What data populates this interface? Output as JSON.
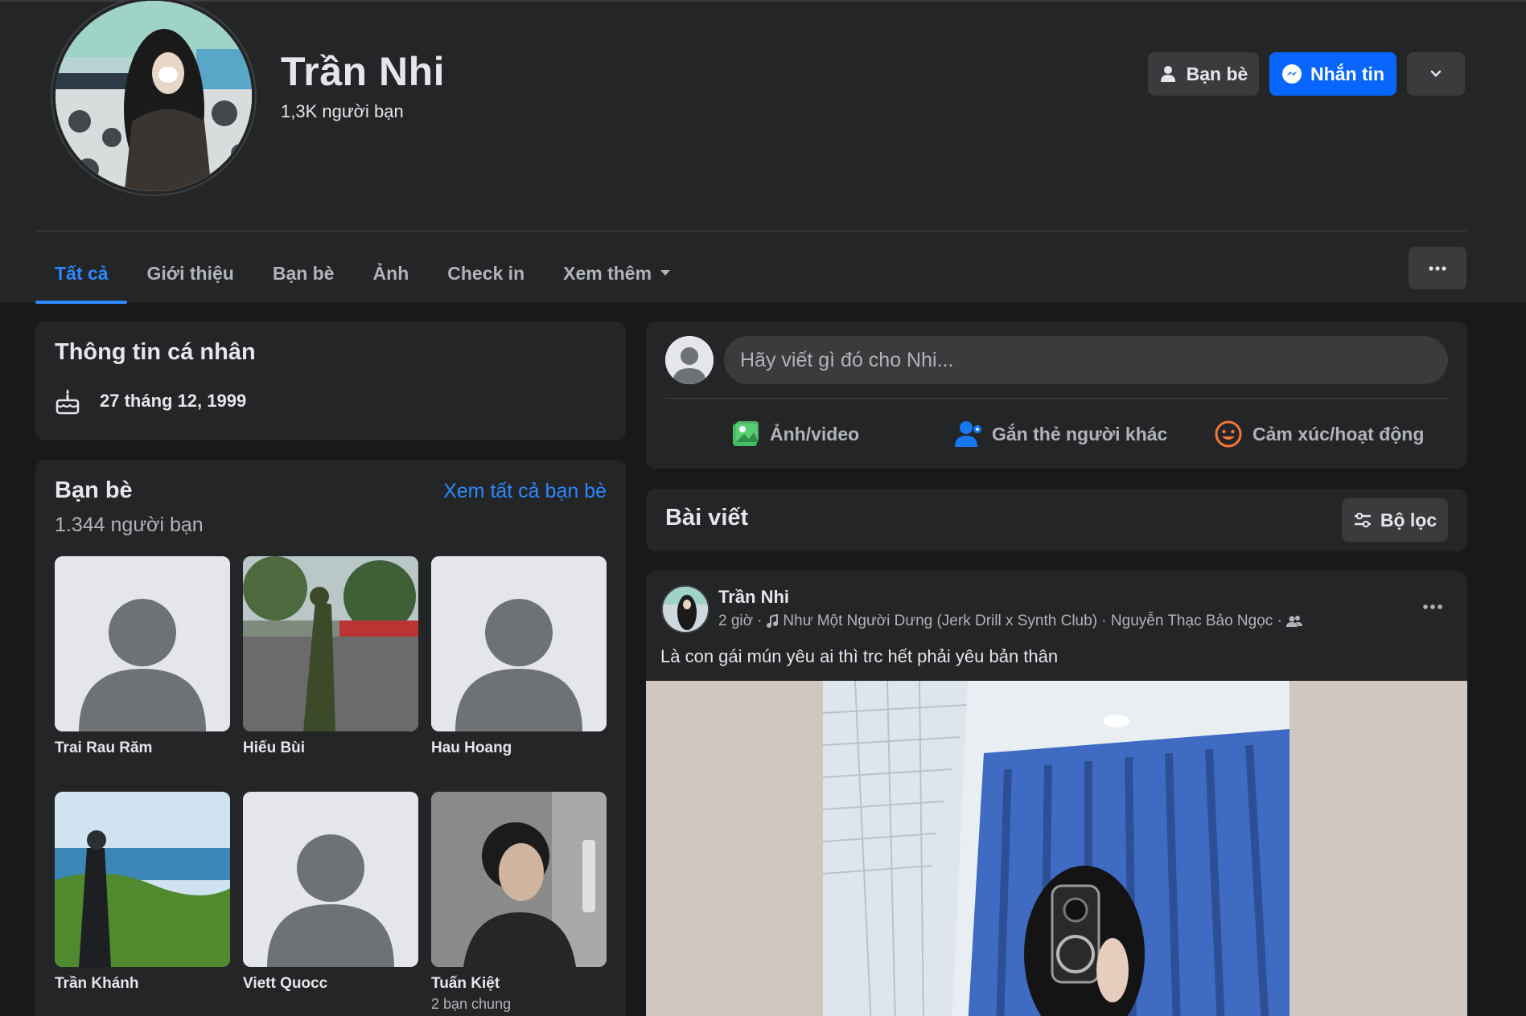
{
  "profile": {
    "name": "Trần Nhi",
    "friends_summary": "1,3K người bạn"
  },
  "header_buttons": {
    "friends": "Bạn bè",
    "message": "Nhắn tin"
  },
  "tabs": [
    {
      "label": "Tất cả",
      "active": true
    },
    {
      "label": "Giới thiệu"
    },
    {
      "label": "Bạn bè"
    },
    {
      "label": "Ảnh"
    },
    {
      "label": "Check in"
    },
    {
      "label": "Xem thêm"
    }
  ],
  "intro": {
    "title": "Thông tin cá nhân",
    "birthday": "27 tháng 12, 1999"
  },
  "friends_section": {
    "title": "Bạn bè",
    "count": "1.344 người bạn",
    "see_all": "Xem tất cả bạn bè",
    "friends": [
      {
        "name": "Trai Rau Răm",
        "photo": "default-avatar"
      },
      {
        "name": "Hiếu Bùi",
        "photo": "soldier-saluting"
      },
      {
        "name": "Hau Hoang",
        "photo": "default-avatar"
      },
      {
        "name": "Trần Khánh",
        "photo": "man-by-sea"
      },
      {
        "name": "Viett Quocc",
        "photo": "default-avatar"
      },
      {
        "name": "Tuấn Kiệt",
        "photo": "young-man-selfie",
        "mutual": "2 bạn chung"
      }
    ]
  },
  "composer": {
    "placeholder": "Hãy viết gì đó cho Nhi...",
    "actions": [
      {
        "label": "Ảnh/video",
        "icon": "photo-video-icon",
        "color": "#45bd62"
      },
      {
        "label": "Gắn thẻ người khác",
        "icon": "tag-people-icon",
        "color": "#1877f2"
      },
      {
        "label": "Cảm xúc/hoạt động",
        "icon": "feeling-icon",
        "color": "#f7b928"
      }
    ]
  },
  "posts_bar": {
    "title": "Bài viết",
    "filter": "Bộ lọc"
  },
  "post": {
    "author": "Trần Nhi",
    "time": "2 giờ",
    "music": "Như Một Người Dưng (Jerk Drill x Synth Club) · Nguyễn Thạc Bảo Ngọc ·",
    "audience": "friends-icon",
    "text": "Là con gái mún yêu ai thì trc hết phải yêu bản thân"
  },
  "colors": {
    "accent": "#2d88ff",
    "messenger_button": "#0866ff",
    "card_bg": "#242526",
    "page_bg": "#18191a"
  }
}
